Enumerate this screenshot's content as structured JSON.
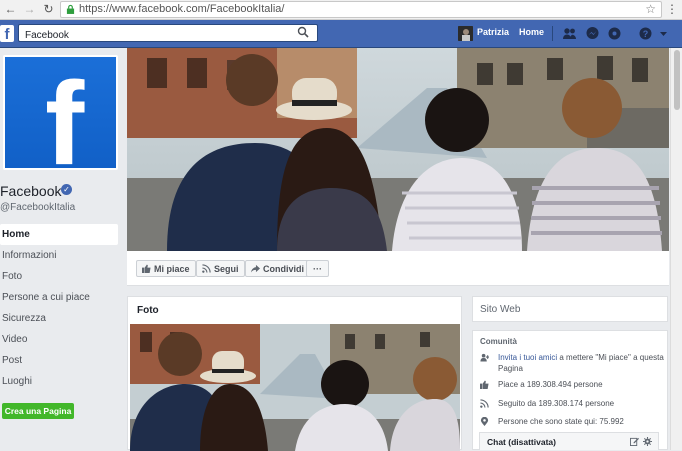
{
  "browser": {
    "url": "https://www.facebook.com/FacebookItalia/"
  },
  "topbar": {
    "logo": "f",
    "search_value": "Facebook",
    "user_name": "Patrizia",
    "home_label": "Home"
  },
  "page": {
    "name": "Facebook",
    "handle": "@FacebookItalia",
    "logo_letter": "f"
  },
  "left_nav": {
    "items": [
      {
        "label": "Home"
      },
      {
        "label": "Informazioni"
      },
      {
        "label": "Foto"
      },
      {
        "label": "Persone a cui piace"
      },
      {
        "label": "Sicurezza"
      },
      {
        "label": "Video"
      },
      {
        "label": "Post"
      },
      {
        "label": "Luoghi"
      }
    ],
    "create_page_label": "Crea una Pagina"
  },
  "actions": {
    "like_label": "Mi piace",
    "follow_label": "Segui",
    "share_label": "Condividi",
    "more_label": "···"
  },
  "photos": {
    "title": "Foto"
  },
  "sidebar": {
    "website_label": "Sito Web",
    "community_title": "Comunità",
    "invite_link": "Invita i tuoi amici",
    "invite_rest": " a mettere \"Mi piace\" a questa Pagina",
    "likes": "Piace a 189.308.494 persone",
    "follows": "Seguito da 189.308.174 persone",
    "been_here": "Persone che sono state qui: 75.992",
    "chat_label": "Chat (disattivata)"
  },
  "colors": {
    "fb_blue": "#4267b2",
    "create_green": "#42b72a"
  }
}
